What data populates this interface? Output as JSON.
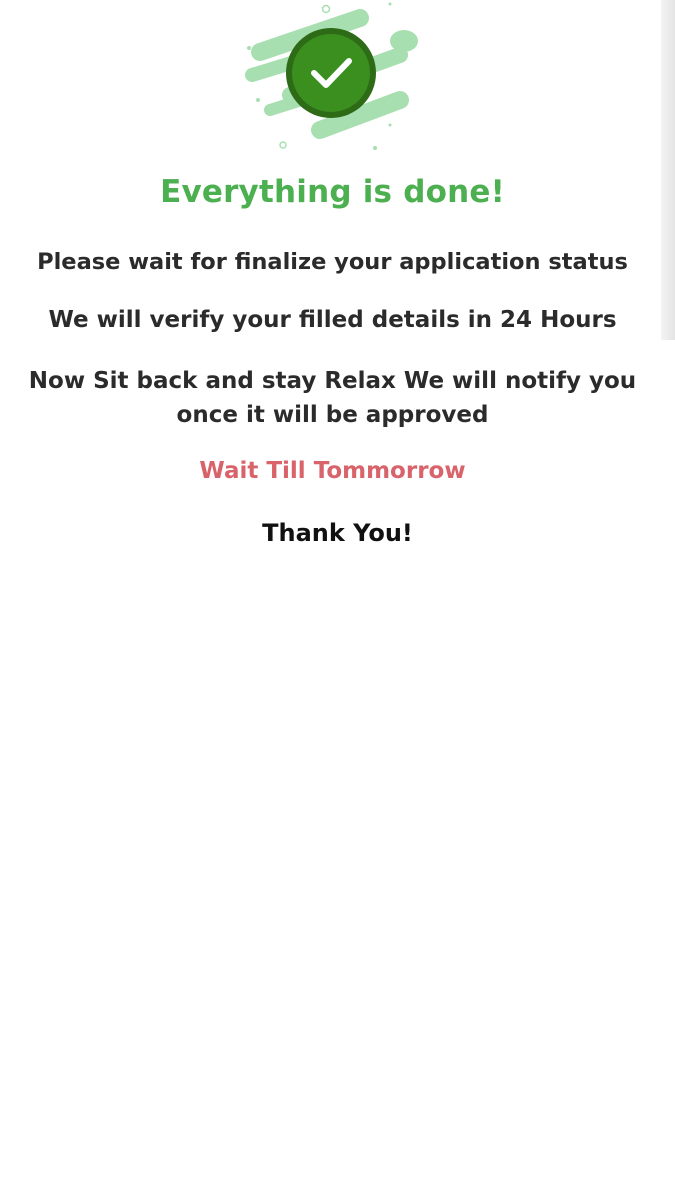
{
  "status": {
    "title": "Everything is done!",
    "line_wait": "Please wait for finalize your application status",
    "line_verify": "We will verify your filled details in 24 Hours",
    "line_relax": "Now Sit back and stay Relax We will notify you once it will be approved",
    "wait_note": "Wait Till Tommorrow",
    "thanks": "Thank You!"
  },
  "icons": {
    "illustration": "success-check-icon"
  },
  "colors": {
    "title": "#4caf50",
    "body_text": "#2b2b2b",
    "wait_note": "#d9636a",
    "thanks": "#111111",
    "badge": "#3a8f1f",
    "badge_ring": "#2e6b17",
    "stripes": "#a8dfb0"
  }
}
